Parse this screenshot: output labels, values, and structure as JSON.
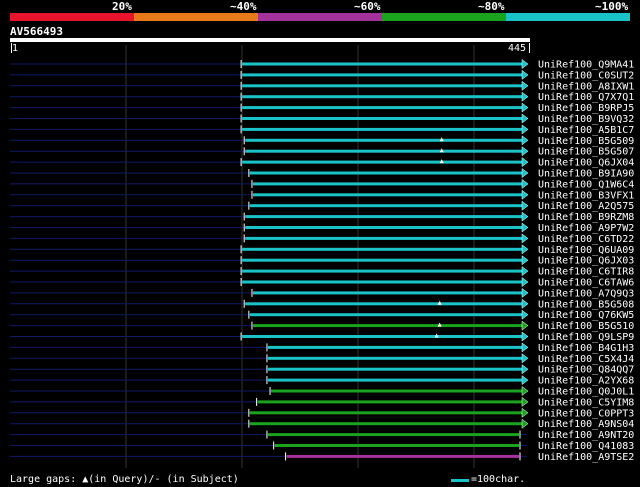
{
  "legend": {
    "labels": [
      "20%",
      "~40%",
      "~60%",
      "~80%",
      "~100%"
    ],
    "colors": [
      "#e8142b",
      "#e87a1c",
      "#a3329c",
      "#1aa31e",
      "#19c3c8"
    ]
  },
  "query": {
    "id": "AV566493",
    "start": "1",
    "end": "445"
  },
  "hits": [
    {
      "name": "UniRef100_Q9MA41",
      "color": "#19c3c8",
      "start": 0.447,
      "arrow": true,
      "gap": null
    },
    {
      "name": "UniRef100_C0SUT2",
      "color": "#19c3c8",
      "start": 0.447,
      "arrow": true,
      "gap": null
    },
    {
      "name": "UniRef100_A8IXW1",
      "color": "#19c3c8",
      "start": 0.447,
      "arrow": true,
      "gap": null
    },
    {
      "name": "UniRef100_Q7X7Q1",
      "color": "#19c3c8",
      "start": 0.447,
      "arrow": true,
      "gap": null
    },
    {
      "name": "UniRef100_B9RPJ5",
      "color": "#19c3c8",
      "start": 0.447,
      "arrow": true,
      "gap": null
    },
    {
      "name": "UniRef100_B9VQ32",
      "color": "#19c3c8",
      "start": 0.447,
      "arrow": true,
      "gap": null
    },
    {
      "name": "UniRef100_A5B1C7",
      "color": "#19c3c8",
      "start": 0.447,
      "arrow": true,
      "gap": null
    },
    {
      "name": "UniRef100_B5G509",
      "color": "#19c3c8",
      "start": 0.453,
      "arrow": true,
      "gap": 0.835
    },
    {
      "name": "UniRef100_B5G507",
      "color": "#19c3c8",
      "start": 0.453,
      "arrow": true,
      "gap": 0.835
    },
    {
      "name": "UniRef100_Q6JX04",
      "color": "#19c3c8",
      "start": 0.447,
      "arrow": true,
      "gap": 0.835
    },
    {
      "name": "UniRef100_B9IA90",
      "color": "#19c3c8",
      "start": 0.462,
      "arrow": true,
      "gap": null
    },
    {
      "name": "UniRef100_Q1W6C4",
      "color": "#19c3c8",
      "start": 0.468,
      "arrow": true,
      "gap": null
    },
    {
      "name": "UniRef100_B3VFX1",
      "color": "#19c3c8",
      "start": 0.468,
      "arrow": true,
      "gap": null
    },
    {
      "name": "UniRef100_A2Q575",
      "color": "#19c3c8",
      "start": 0.462,
      "arrow": true,
      "gap": null
    },
    {
      "name": "UniRef100_B9RZM8",
      "color": "#19c3c8",
      "start": 0.453,
      "arrow": true,
      "gap": null
    },
    {
      "name": "UniRef100_A9P7W2",
      "color": "#19c3c8",
      "start": 0.453,
      "arrow": true,
      "gap": null
    },
    {
      "name": "UniRef100_C6TD22",
      "color": "#19c3c8",
      "start": 0.453,
      "arrow": true,
      "gap": null
    },
    {
      "name": "UniRef100_Q6UA09",
      "color": "#19c3c8",
      "start": 0.447,
      "arrow": true,
      "gap": null
    },
    {
      "name": "UniRef100_Q6JX03",
      "color": "#19c3c8",
      "start": 0.447,
      "arrow": true,
      "gap": null
    },
    {
      "name": "UniRef100_C6TIR8",
      "color": "#19c3c8",
      "start": 0.447,
      "arrow": true,
      "gap": null
    },
    {
      "name": "UniRef100_C6TAW6",
      "color": "#19c3c8",
      "start": 0.447,
      "arrow": true,
      "gap": null
    },
    {
      "name": "UniRef100_A7Q9Q3",
      "color": "#19c3c8",
      "start": 0.468,
      "arrow": true,
      "gap": null
    },
    {
      "name": "UniRef100_B5G508",
      "color": "#19c3c8",
      "start": 0.453,
      "arrow": true,
      "gap": 0.831
    },
    {
      "name": "UniRef100_Q76KW5",
      "color": "#19c3c8",
      "start": 0.462,
      "arrow": true,
      "gap": null
    },
    {
      "name": "UniRef100_B5G510",
      "color": "#1aa31e",
      "start": 0.468,
      "arrow": true,
      "gap": 0.831
    },
    {
      "name": "UniRef100_Q9LSP9",
      "color": "#19c3c8",
      "start": 0.447,
      "arrow": true,
      "gap": 0.825
    },
    {
      "name": "UniRef100_B4G1H3",
      "color": "#19c3c8",
      "start": 0.497,
      "arrow": true,
      "gap": null
    },
    {
      "name": "UniRef100_C5X4J4",
      "color": "#19c3c8",
      "start": 0.497,
      "arrow": true,
      "gap": null
    },
    {
      "name": "UniRef100_Q84QQ7",
      "color": "#19c3c8",
      "start": 0.497,
      "arrow": true,
      "gap": null
    },
    {
      "name": "UniRef100_A2YX68",
      "color": "#19c3c8",
      "start": 0.497,
      "arrow": true,
      "gap": null
    },
    {
      "name": "UniRef100_Q0J0L1",
      "color": "#1aa31e",
      "start": 0.503,
      "arrow": true,
      "gap": null
    },
    {
      "name": "UniRef100_C5YIM8",
      "color": "#1aa31e",
      "start": 0.477,
      "arrow": true,
      "gap": null
    },
    {
      "name": "UniRef100_C0PPT3",
      "color": "#1aa31e",
      "start": 0.462,
      "arrow": true,
      "gap": null
    },
    {
      "name": "UniRef100_A9NS04",
      "color": "#1aa31e",
      "start": 0.462,
      "arrow": true,
      "gap": null
    },
    {
      "name": "UniRef100_A9NT20",
      "color": "#1aa31e",
      "start": 0.497,
      "arrow": false,
      "gap": null
    },
    {
      "name": "UniRef100_Q41083",
      "color": "#1aa31e",
      "start": 0.51,
      "arrow": false,
      "gap": null
    },
    {
      "name": "UniRef100_A9TSE2",
      "color": "#a3329c",
      "start": 0.533,
      "arrow": false,
      "gap": null
    }
  ],
  "footer": {
    "gaps_text": "Large gaps: ▲(in Query)/- (in Subject)",
    "scale_text": "=100char."
  }
}
